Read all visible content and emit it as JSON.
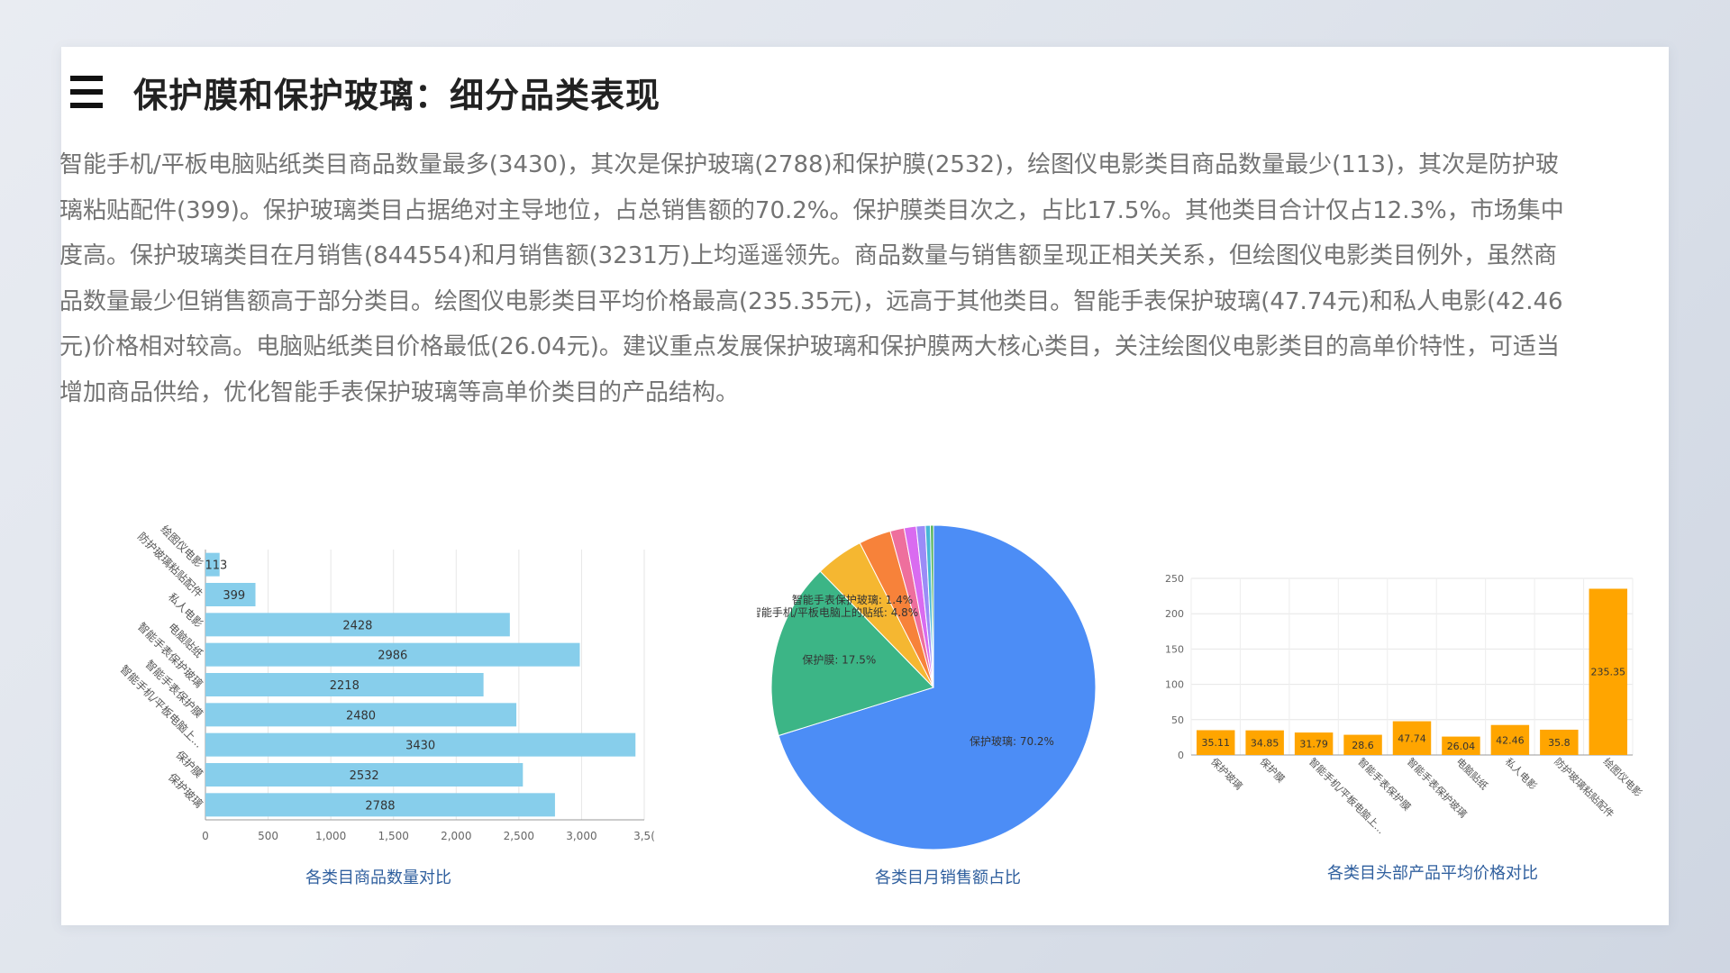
{
  "page": {
    "title": "保护膜和保护玻璃：细分品类表现",
    "paragraph": "智能手机/平板电脑贴纸类目商品数量最多(3430)，其次是保护玻璃(2788)和保护膜(2532)，绘图仪电影类目商品数量最少(113)，其次是防护玻璃粘贴配件(399)。保护玻璃类目占据绝对主导地位，占总销售额的70.2%。保护膜类目次之，占比17.5%。其他类目合计仅占12.3%，市场集中度高。保护玻璃类目在月销售(844554)和月销售额(3231万)上均遥遥领先。商品数量与销售额呈现正相关关系，但绘图仪电影类目例外，虽然商品数量最少但销售额高于部分类目。绘图仪电影类目平均价格最高(235.35元)，远高于其他类目。智能手表保护玻璃(47.74元)和私人电影(42.46元)价格相对较高。电脑贴纸类目价格最低(26.04元)。建议重点发展保护玻璃和保护膜两大核心类目，关注绘图仪电影类目的高单价特性，可适当增加商品供给，优化智能手表保护玻璃等高单价类目的产品结构。"
  },
  "chart_data": [
    {
      "type": "bar",
      "orientation": "horizontal",
      "caption": "各类目商品数量对比",
      "categories": [
        "绘图仪电影",
        "防护玻璃粘贴配件",
        "私人电影",
        "电脑贴纸",
        "智能手表保护玻璃",
        "智能手表保护膜",
        "智能手机/平板电脑上...",
        "保护膜",
        "保护玻璃"
      ],
      "values": [
        113,
        399,
        2428,
        2986,
        2218,
        2480,
        3430,
        2532,
        2788
      ],
      "xlim": [
        0,
        3500
      ],
      "xticks": [
        "0",
        "500",
        "1,000",
        "1,500",
        "2,000",
        "2,500",
        "3,000",
        "3,5("
      ],
      "color": "#87ceeb",
      "grid": true
    },
    {
      "type": "pie",
      "caption": "各类目月销售额占比",
      "slices": [
        {
          "label": "保护玻璃: 70.2%",
          "value": 70.2,
          "color": "#4c8df6"
        },
        {
          "label": "保护膜: 17.5%",
          "value": 17.5,
          "color": "#3cb586"
        },
        {
          "label": "智能手机/平板电脑上的贴纸: 4.8%",
          "value": 4.8,
          "color": "#f5b731"
        },
        {
          "label": "",
          "value": 3.2,
          "color": "#f7823a"
        },
        {
          "label": "智能手表保护玻璃: 1.4%",
          "value": 1.4,
          "color": "#ee6f9d"
        },
        {
          "label": "",
          "value": 1.2,
          "color": "#d96bf0"
        },
        {
          "label": "",
          "value": 0.9,
          "color": "#9b8cf7"
        },
        {
          "label": "",
          "value": 0.5,
          "color": "#47b8d6"
        },
        {
          "label": "",
          "value": 0.3,
          "color": "#4caf50"
        }
      ]
    },
    {
      "type": "bar",
      "caption": "各类目头部产品平均价格对比",
      "categories": [
        "保护玻璃",
        "保护膜",
        "智能手机/平板电脑上...",
        "智能手表保护膜",
        "智能手表保护玻璃",
        "电脑贴纸",
        "私人电影",
        "防护玻璃粘贴配件",
        "绘图仪电影"
      ],
      "values": [
        35.11,
        34.85,
        31.79,
        28.6,
        47.74,
        26.04,
        42.46,
        35.8,
        235.35
      ],
      "ylim": [
        0,
        250
      ],
      "yticks": [
        "0",
        "50",
        "100",
        "150",
        "200",
        "250"
      ],
      "color": "#ffa500",
      "grid": true
    }
  ]
}
